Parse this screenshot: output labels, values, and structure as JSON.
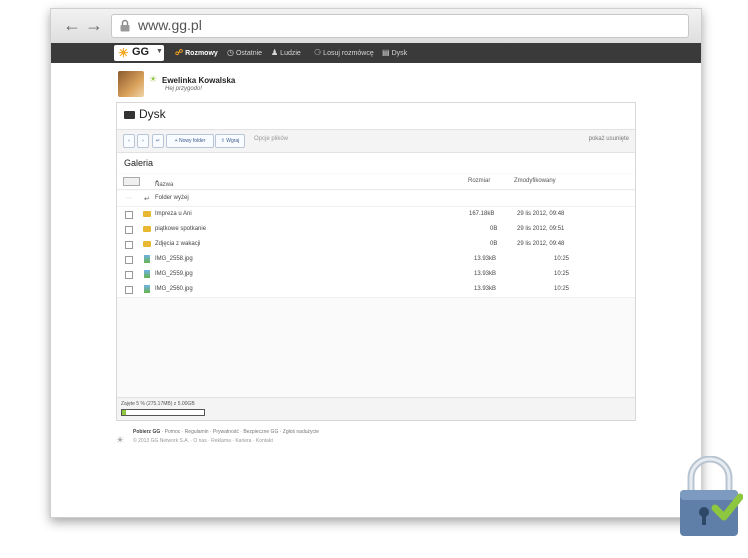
{
  "browser": {
    "back_icon": "arrow-left-icon",
    "forward_icon": "arrow-right-icon",
    "url": "www.gg.pl"
  },
  "nav": {
    "logo": "GG",
    "items": [
      {
        "label": "Rozmowy",
        "icon": "chat-icon",
        "active": true
      },
      {
        "label": "Ostatnie",
        "icon": "clock-icon",
        "active": false
      },
      {
        "label": "Ludzie",
        "icon": "people-icon",
        "active": false
      },
      {
        "label": "Losuj rozmówcę",
        "icon": "random-chat-icon",
        "active": false
      },
      {
        "label": "Dysk",
        "icon": "folder-icon",
        "active": false
      }
    ]
  },
  "user": {
    "name": "Ewelinka Kowalska",
    "status": "Hej przygodo!"
  },
  "panel": {
    "title": "Dysk",
    "toolbar": {
      "new_folder": "Nowy folder",
      "upload": "Wgraj",
      "file_options": "Opcje plików",
      "show_deleted": "pokaż usunięte"
    },
    "gallery_title": "Galeria",
    "columns": {
      "name": "Nazwa",
      "sort_indicator": "▲",
      "size": "Rozmiar",
      "modified": "Zmodyfikowany"
    },
    "up_folder": "Folder wyżej",
    "rows": [
      {
        "name": "Impreza u Ani",
        "type": "folder",
        "size": "167.18kB",
        "modified": "29 lis 2012, 09:48"
      },
      {
        "name": "piątkowe spotkanie",
        "type": "folder",
        "size": "0B",
        "modified": "29 lis 2012, 09:51"
      },
      {
        "name": "Zdjęcia z wakacji",
        "type": "folder",
        "size": "0B",
        "modified": "29 lis 2012, 09:48"
      },
      {
        "name": "IMG_2558.jpg",
        "type": "image",
        "size": "13.93kB",
        "modified": "10:25"
      },
      {
        "name": "IMG_2559.jpg",
        "type": "image",
        "size": "13.93kB",
        "modified": "10:25"
      },
      {
        "name": "IMG_2560.jpg",
        "type": "image",
        "size": "13.93kB",
        "modified": "10:25"
      }
    ],
    "storage": {
      "text": "Zajęte 5 % (275.17MB) z 5.00GB",
      "percent": 5
    }
  },
  "footer": {
    "download": "Pobierz GG",
    "links": " · Pomoc · Regulamin · Prywatność · Bezpieczne GG · Zgłoś nadużycie",
    "copyright": "© 2013 GG Network S.A. · O nas · Reklama · Kariera · Kontakt"
  },
  "colors": {
    "nav_bg": "#3a3a3a",
    "accent_green": "#8dc63f",
    "folder": "#e8b833",
    "lock_body": "#5f7fa8"
  }
}
